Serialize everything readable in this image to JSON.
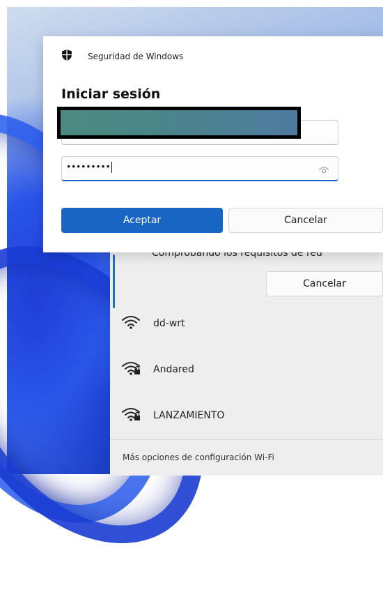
{
  "dialog": {
    "app_title": "Seguridad de Windows",
    "heading": "Iniciar sesión",
    "password_mask": "•••••••••",
    "accept_label": "Aceptar",
    "cancel_label": "Cancelar"
  },
  "wifi_panel": {
    "status_text": "Comprobando los requisitos de red",
    "cancel_label": "Cancelar",
    "networks": [
      {
        "name": "dd-wrt",
        "icon": "wifi-open-icon"
      },
      {
        "name": "Andared",
        "icon": "wifi-secured-icon"
      },
      {
        "name": "LANZAMIENTO",
        "icon": "wifi-secured-icon"
      }
    ],
    "more_settings": "Más opciones de configuración Wi-Fi"
  },
  "colors": {
    "accent": "#1865c3",
    "wallpaper": "#2a55e8"
  }
}
